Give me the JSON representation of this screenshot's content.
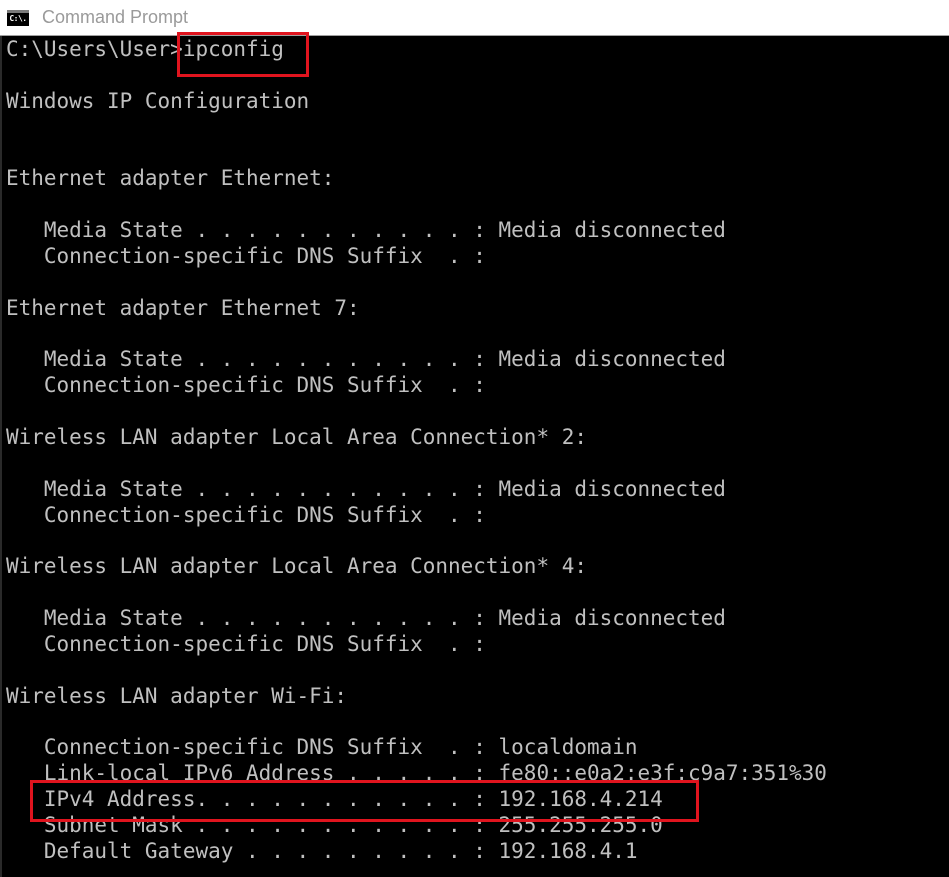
{
  "window": {
    "title": "Command Prompt",
    "icon": "cmd-icon",
    "icon_text": "C:\\."
  },
  "console": {
    "lines": [
      "C:\\Users\\User>ipconfig",
      "",
      "Windows IP Configuration",
      "",
      "",
      "Ethernet adapter Ethernet:",
      "",
      "   Media State . . . . . . . . . . . : Media disconnected",
      "   Connection-specific DNS Suffix  . :",
      "",
      "Ethernet adapter Ethernet 7:",
      "",
      "   Media State . . . . . . . . . . . : Media disconnected",
      "   Connection-specific DNS Suffix  . :",
      "",
      "Wireless LAN adapter Local Area Connection* 2:",
      "",
      "   Media State . . . . . . . . . . . : Media disconnected",
      "   Connection-specific DNS Suffix  . :",
      "",
      "Wireless LAN adapter Local Area Connection* 4:",
      "",
      "   Media State . . . . . . . . . . . : Media disconnected",
      "   Connection-specific DNS Suffix  . :",
      "",
      "Wireless LAN adapter Wi-Fi:",
      "",
      "   Connection-specific DNS Suffix  . : localdomain",
      "   Link-local IPv6 Address . . . . . : fe80::e0a2:e3f:c9a7:351%30",
      "   IPv4 Address. . . . . . . . . . . : 192.168.4.214",
      "   Subnet Mask . . . . . . . . . . . : 255.255.255.0",
      "   Default Gateway . . . . . . . . . : 192.168.4.1"
    ]
  },
  "annotations": {
    "color": "#e0141e",
    "boxes": [
      {
        "label": "ipconfig-command",
        "target_line": 0,
        "target_text": "ipconfig"
      },
      {
        "label": "ipv4-address",
        "target_line": 29,
        "target_text": "IPv4 Address. . . . . . . . . . . : 192.168.4.214"
      }
    ]
  }
}
